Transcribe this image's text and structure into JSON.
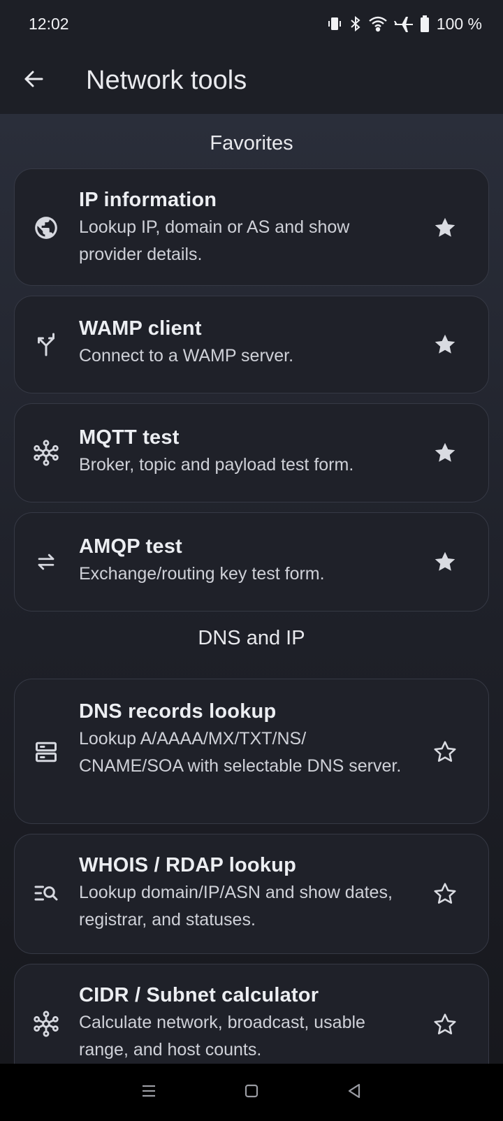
{
  "status": {
    "time": "12:02",
    "battery": "100 %"
  },
  "app_bar": {
    "title": "Network tools"
  },
  "sections": {
    "favorites": "Favorites",
    "dns_ip": "DNS and IP"
  },
  "favorites": [
    {
      "title": "IP information",
      "desc": "Lookup IP, domain or AS and show provider details.",
      "icon": "globe-icon",
      "favorite": true
    },
    {
      "title": "WAMP client",
      "desc": "Connect to a WAMP server.",
      "icon": "fork-icon",
      "favorite": true
    },
    {
      "title": "MQTT test",
      "desc": "Broker, topic and payload test form.",
      "icon": "hub-icon",
      "favorite": true
    },
    {
      "title": "AMQP test",
      "desc": "Exchange/routing key test form.",
      "icon": "swap-icon",
      "favorite": true
    }
  ],
  "dns_ip": [
    {
      "title": "DNS records lookup",
      "desc": "Lookup A/AAAA/MX/TXT/NS/ CNAME/SOA with selectable DNS server.",
      "icon": "dns-server-icon",
      "favorite": false
    },
    {
      "title": "WHOIS / RDAP lookup",
      "desc": "Lookup domain/IP/ASN and show dates, registrar, and statuses.",
      "icon": "list-search-icon",
      "favorite": false
    },
    {
      "title": "CIDR / Subnet calculator",
      "desc": "Calculate network, broadcast, usable range, and host counts.",
      "icon": "hub-icon",
      "favorite": false
    }
  ],
  "colors": {
    "accent_star": "#d9dbe1",
    "card_bg": "#1f2129",
    "app_bar_bg": "#1d1f26"
  }
}
